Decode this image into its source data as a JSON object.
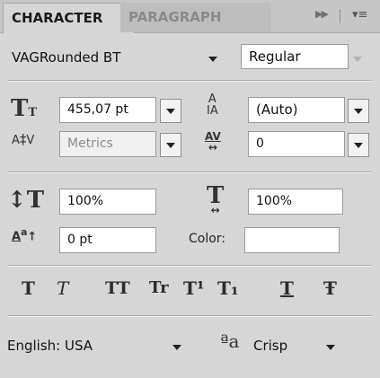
{
  "tabs": {
    "character": "CHARACTER",
    "paragraph": "PARAGRAPH"
  },
  "font": {
    "family": "VAGRounded BT",
    "style": "Regular"
  },
  "size": {
    "value": "455,07 pt"
  },
  "leading": {
    "value": "(Auto)"
  },
  "kerning": {
    "value": "Metrics"
  },
  "tracking": {
    "value": "0"
  },
  "vertical_scale": {
    "value": "100%"
  },
  "horizontal_scale": {
    "value": "100%"
  },
  "baseline_shift": {
    "value": "0 pt"
  },
  "color": {
    "label": "Color:",
    "swatch": "#ffffff"
  },
  "language": {
    "value": "English: USA"
  },
  "antialias": {
    "icon_text": "ªa",
    "value": "Crisp"
  },
  "icons": {
    "size": "T-size-icon",
    "leading": "A-leading-icon",
    "kerning": "AV-kerning-icon",
    "tracking": "AV-tracking-icon",
    "vscale": "IT-vertical-scale-icon",
    "hscale": "T-horizontal-scale-icon",
    "baseline": "Aa-baseline-icon"
  },
  "style_buttons": [
    "T",
    "T",
    "TT",
    "Tr",
    "T¹",
    "T₁",
    "T",
    "Ŧ"
  ]
}
